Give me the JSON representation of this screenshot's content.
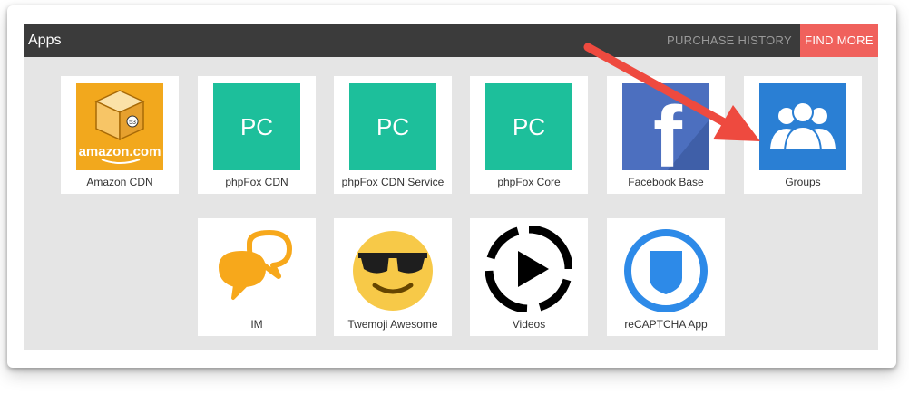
{
  "header": {
    "title": "Apps",
    "purchase_history": "PURCHASE HISTORY",
    "find_more": "FIND MORE"
  },
  "apps": [
    {
      "label": "Amazon CDN",
      "icon": "amazon-cdn-icon",
      "art_text": "amazon.com",
      "badge": "53"
    },
    {
      "label": "phpFox CDN",
      "icon": "phpfox-pc-icon",
      "art_text": "PC"
    },
    {
      "label": "phpFox CDN Service",
      "icon": "phpfox-pc-icon",
      "art_text": "PC"
    },
    {
      "label": "phpFox Core",
      "icon": "phpfox-pc-icon",
      "art_text": "PC"
    },
    {
      "label": "Facebook Base",
      "icon": "facebook-icon",
      "art_text": "f"
    },
    {
      "label": "Groups",
      "icon": "groups-icon"
    },
    {
      "label": "IM",
      "icon": "chat-bubbles-icon"
    },
    {
      "label": "Twemoji Awesome",
      "icon": "sunglasses-emoji-icon"
    },
    {
      "label": "Videos",
      "icon": "play-icon"
    },
    {
      "label": "reCAPTCHA App",
      "icon": "shield-icon"
    }
  ],
  "colors": {
    "header_bg": "#3b3b3b",
    "find_more_bg": "#f0615c",
    "phpfox_teal": "#1dbf9b",
    "facebook_blue": "#4c6fbf",
    "groups_blue": "#2a7fd4",
    "annotation_arrow": "#ee4a3f"
  }
}
